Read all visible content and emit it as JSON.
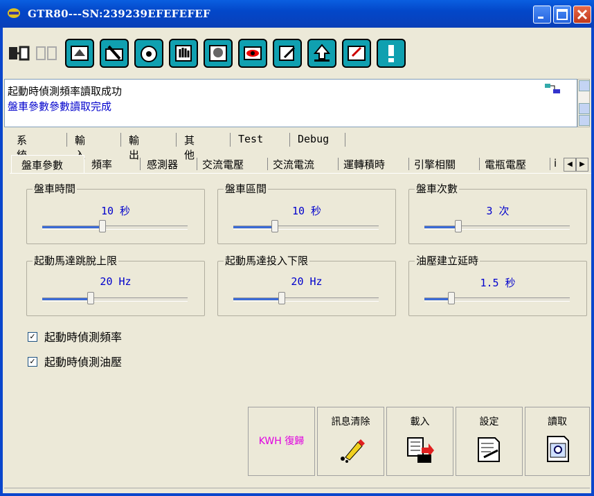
{
  "window": {
    "title": "GTR80---SN:239239EFEFEFEF"
  },
  "toolbar": {
    "icons": [
      "connect-icon",
      "disconnect-icon",
      "upload-icon",
      "tools-icon",
      "gauge-icon",
      "hand-icon",
      "engine-icon",
      "eye-icon",
      "edit-icon",
      "upload-arrow-icon",
      "sign-icon",
      "alert-icon"
    ]
  },
  "messages": {
    "line1": "起動時偵測頻率讀取成功",
    "line2": "盤車參數參數讀取完成",
    "status_icon": "network-status-icon"
  },
  "tabs_main": [
    "系統",
    "輸入",
    "輸出",
    "其他",
    "Test",
    "Debug"
  ],
  "tabs_sub": [
    "盤車參數",
    "頻率",
    "感測器",
    "交流電壓",
    "交流電流",
    "運轉積時",
    "引擎相關",
    "電瓶電壓",
    "i"
  ],
  "groups": [
    {
      "title": "盤車時間",
      "value": "10 秒",
      "level": 0.4
    },
    {
      "title": "盤車區間",
      "value": "10 秒",
      "level": 0.27
    },
    {
      "title": "盤車次數",
      "value": "3 次",
      "level": 0.22
    },
    {
      "title": "起動馬達跳脫上限",
      "value": "20 Hz",
      "level": 0.32
    },
    {
      "title": "起動馬達投入下限",
      "value": "20 Hz",
      "level": 0.32
    },
    {
      "title": "油壓建立延時",
      "value": "1.5 秒",
      "level": 0.17
    }
  ],
  "checkboxes": [
    {
      "label": "起動時偵測頻率",
      "checked": true
    },
    {
      "label": "起動時偵測油壓",
      "checked": true
    }
  ],
  "buttons": {
    "kwh": "KWH 復歸",
    "clear": "訊息清除",
    "load": "載入",
    "set": "設定",
    "read": "讀取"
  },
  "colors": {
    "accent": "#0000cc",
    "kwh_text": "#e000e0",
    "slider_fill": "#3a6ad6"
  }
}
